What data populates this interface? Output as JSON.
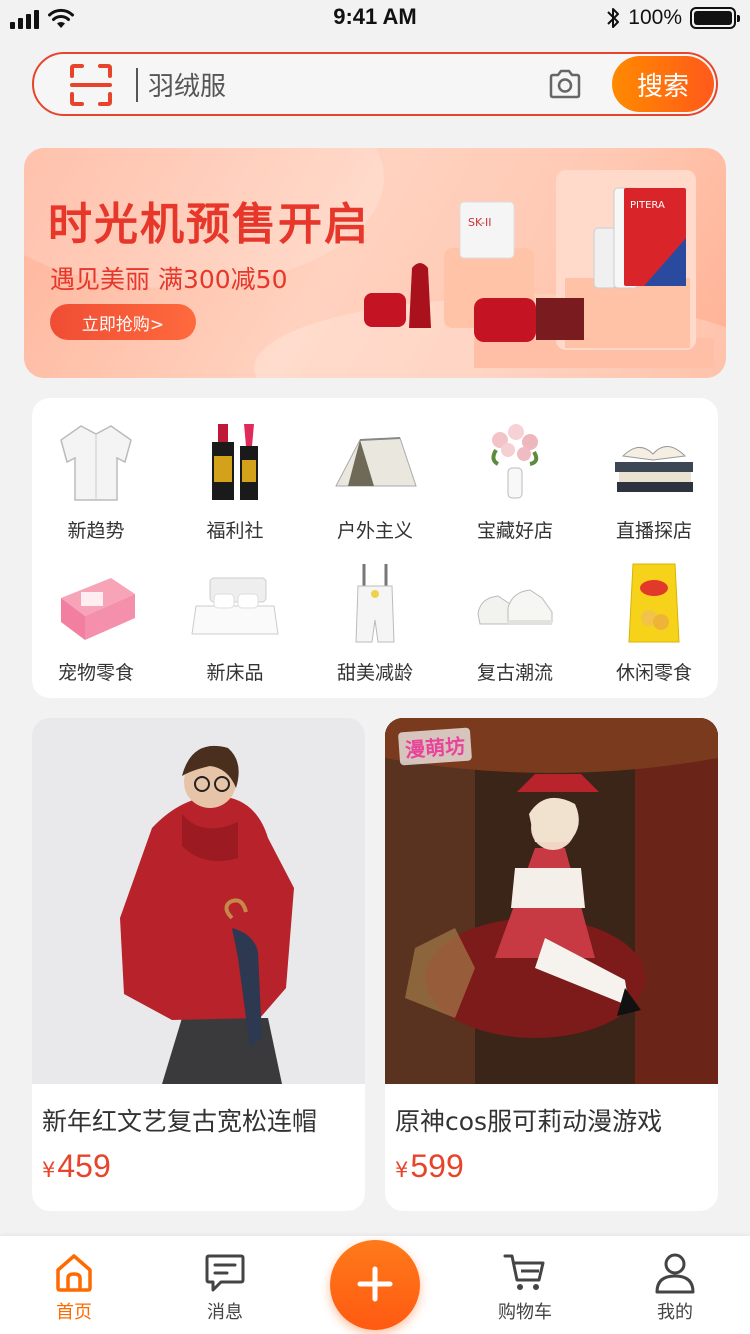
{
  "status_bar": {
    "time": "9:41 AM",
    "battery": "100%"
  },
  "search": {
    "value": "羽绒服",
    "button_label": "搜索"
  },
  "banner": {
    "title": "时光机预售开启",
    "subtitle": "遇见美丽 满300减50",
    "button_label": "立即抢购>",
    "brand": "PITERA",
    "brand_sk": "SK-II"
  },
  "categories": [
    {
      "label": "新趋势"
    },
    {
      "label": "福利社"
    },
    {
      "label": "户外主义"
    },
    {
      "label": "宝藏好店"
    },
    {
      "label": "直播探店"
    },
    {
      "label": "宠物零食"
    },
    {
      "label": "新床品"
    },
    {
      "label": "甜美减龄"
    },
    {
      "label": "复古潮流"
    },
    {
      "label": "休闲零食"
    }
  ],
  "products": [
    {
      "title": "新年红文艺复古宽松连帽",
      "currency": "¥",
      "price": "459"
    },
    {
      "title": "原神cos服可莉动漫游戏",
      "currency": "¥",
      "price": "599",
      "badge": "漫萌坊"
    }
  ],
  "tabbar": {
    "home": "首页",
    "messages": "消息",
    "cart": "购物车",
    "me": "我的"
  },
  "colors": {
    "accent": "#ff6a00",
    "brand_red": "#e8442b"
  }
}
